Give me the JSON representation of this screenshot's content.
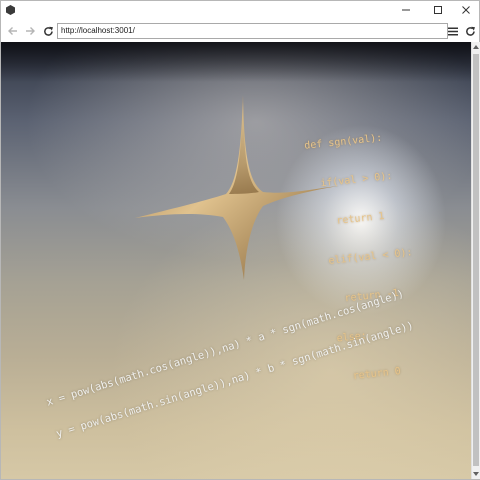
{
  "browser": {
    "address": "http://localhost:3001/",
    "icons": {
      "app": "app-icon",
      "minimize": "minimize-icon",
      "maximize": "maximize-icon",
      "close": "close-icon",
      "back": "back-arrow-icon",
      "forward": "forward-arrow-icon",
      "reload": "reload-icon",
      "menu": "hamburger-menu-icon"
    }
  },
  "scene": {
    "sgn_code": [
      "def sgn(val):",
      "  if(val > 0):",
      "    return 1",
      "  elif(val < 0):",
      "    return -1",
      "  else:",
      "    return 0"
    ],
    "formula_lines": [
      "x = pow(abs(math.cos(angle)),na) * a * sgn(math.cos(angle))",
      "y = pow(abs(math.sin(angle)),na) * b * sgn(math.sin(angle))"
    ],
    "colors": {
      "star": "#c9a872",
      "code": "#e7c48a"
    }
  }
}
